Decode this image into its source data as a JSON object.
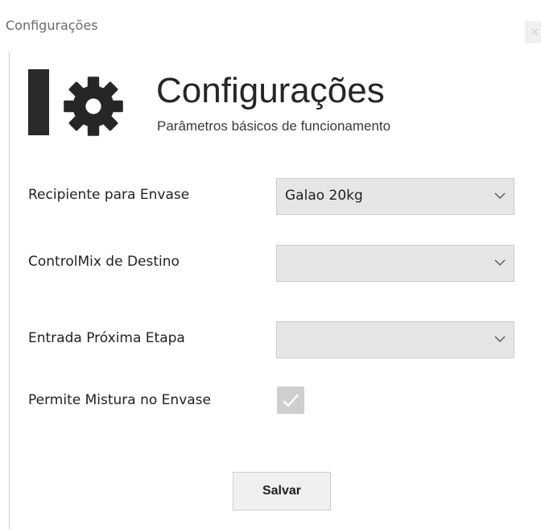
{
  "window": {
    "title": "Configurações",
    "close_glyph": "×"
  },
  "header": {
    "icon": "gear-icon",
    "title": "Configurações",
    "subtitle": "Parâmetros básicos de funcionamento"
  },
  "form": {
    "recipiente": {
      "label": "Recipiente para Envase",
      "value": "Galao 20kg"
    },
    "controlmix": {
      "label": "ControlMix de Destino",
      "value": ""
    },
    "entrada": {
      "label": "Entrada Próxima Etapa",
      "value": ""
    },
    "mistura": {
      "label": "Permite Mistura no Envase",
      "checked": true
    }
  },
  "actions": {
    "save_label": "Salvar"
  },
  "colors": {
    "accent_bar": "#2a2a2a",
    "combo_bg": "#e6e6e6",
    "checkbox_bg": "#cfcfcf"
  }
}
